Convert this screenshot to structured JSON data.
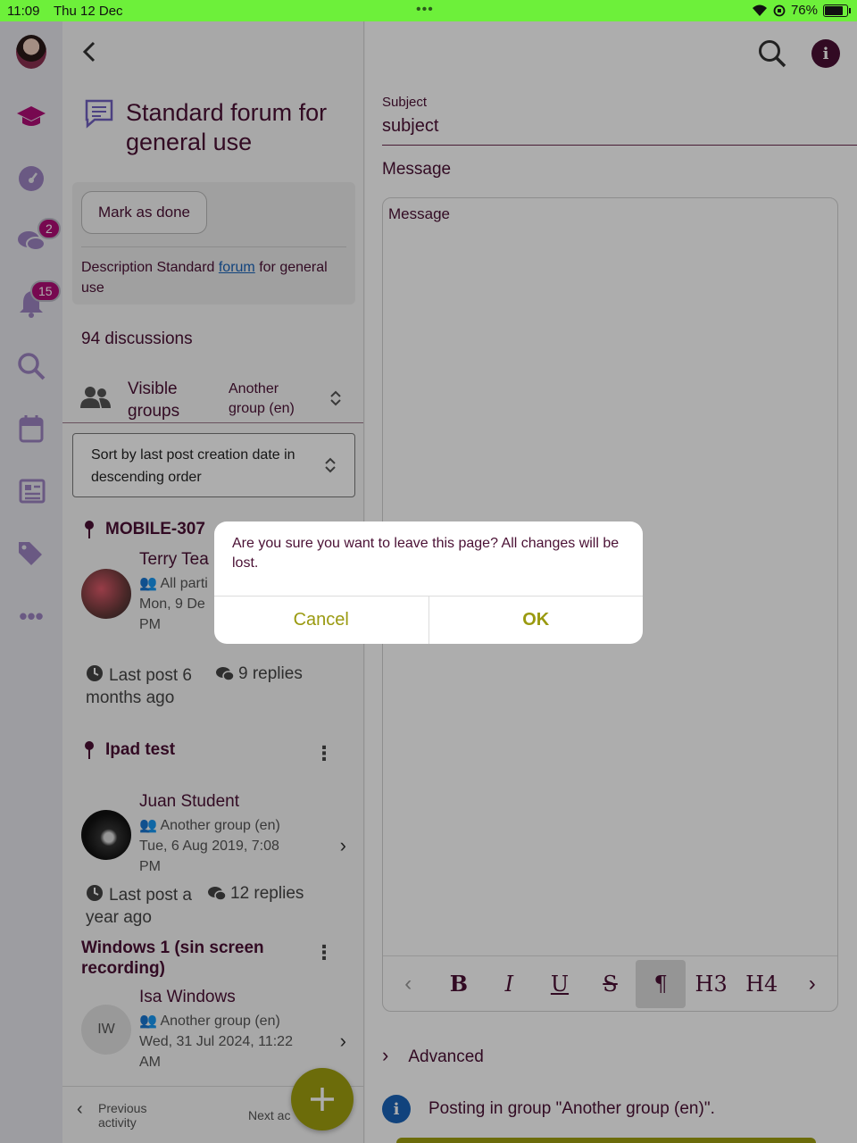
{
  "status_bar": {
    "time": "11:09",
    "date": "Thu 12 Dec",
    "battery": "76%",
    "battery_level": 0.76
  },
  "rail": {
    "messages_badge": "2",
    "notifications_badge": "15"
  },
  "forum": {
    "title": "Standard forum for general use",
    "mark_done_label": "Mark as done",
    "description_prefix": "Description Standard ",
    "description_link": "forum",
    "description_suffix": " for general use",
    "discussion_count": "94 discussions",
    "groups_label": "Visible groups",
    "groups_value": "Another group (en)",
    "sort_label": "Sort by last post creation date in descending order"
  },
  "discussions": [
    {
      "title": "MOBILE-307",
      "author": "Terry Tea",
      "group": "All parti",
      "date": "Mon, 9 De",
      "date2": "PM",
      "last_post": "Last post 6 months ago",
      "replies": "9 replies"
    },
    {
      "title": "Ipad test",
      "author": "Juan Student",
      "group": "Another group (en)",
      "date": "Tue, 6 Aug 2019, 7:08",
      "date2": "PM",
      "last_post": "Last post a year ago",
      "replies": "12 replies"
    },
    {
      "title": "Windows 1 (sin screen recording)",
      "author": "Isa Windows",
      "initials": "IW",
      "group": "Another group (en)",
      "date": "Wed, 31 Jul 2024, 11:22",
      "date2": "AM"
    }
  ],
  "bottom_nav": {
    "previous": "Previous activity",
    "next": "Next ac"
  },
  "editor": {
    "subject_label": "Subject",
    "subject_value": "subject",
    "message_label": "Message",
    "message_placeholder": "Message",
    "toolbar": [
      "‹",
      "B",
      "I",
      "U",
      "S",
      "¶",
      "H3",
      "H4",
      "›"
    ],
    "advanced_label": "Advanced",
    "posting_info": "Posting in group \"Another group (en)\"."
  },
  "dialog": {
    "message": "Are you sure you want to leave this page? All changes will be lost.",
    "cancel_label": "Cancel",
    "ok_label": "OK"
  },
  "colors": {
    "status_bar": "#6df03a",
    "accent": "#a0a010",
    "brand": "#4a1034",
    "badge": "#b00d76"
  }
}
